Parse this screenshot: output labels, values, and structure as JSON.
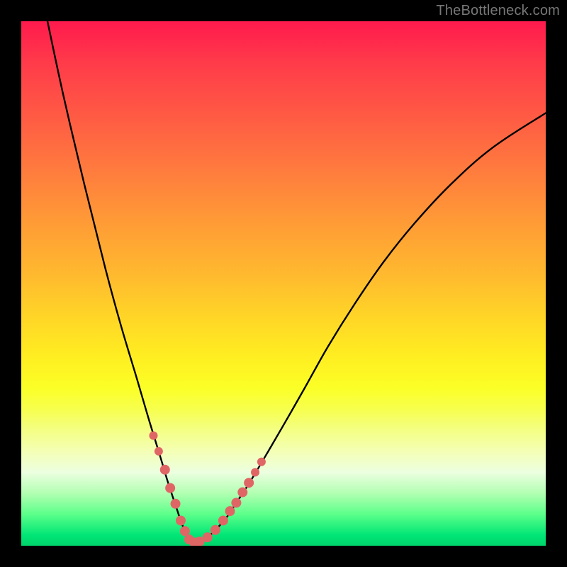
{
  "watermark": "TheBottleneck.com",
  "colors": {
    "background": "#000000",
    "curve": "#000000",
    "markers": "#e06666",
    "gradient_stops": [
      "#ff1a4d",
      "#ff3b4a",
      "#ff5a44",
      "#ff7a3e",
      "#ff9a36",
      "#ffb82f",
      "#ffd427",
      "#ffee21",
      "#fbff27",
      "#f7ff4e",
      "#f4ff85",
      "#f4ffb5",
      "#ecffe0",
      "#b2ffb2",
      "#5cff8a",
      "#00e676",
      "#00d46a"
    ]
  },
  "chart_data": {
    "type": "line",
    "title": "",
    "xlabel": "",
    "ylabel": "",
    "xlim": [
      0,
      100
    ],
    "ylim": [
      0,
      100
    ],
    "grid": false,
    "series": [
      {
        "name": "curve",
        "x": [
          5,
          8,
          12,
          16,
          19,
          22,
          24.5,
          26.5,
          28,
          29.5,
          30.4,
          31.2,
          32,
          33,
          34,
          35.5,
          37,
          39,
          41,
          43.5,
          46.5,
          50,
          54,
          58.5,
          63.5,
          69,
          75,
          82,
          90,
          100
        ],
        "y": [
          100,
          86,
          69,
          53,
          42,
          32,
          23.5,
          17,
          12,
          7.5,
          4.8,
          2.8,
          1.2,
          0.6,
          0.8,
          1.6,
          3,
          5.2,
          8.2,
          12,
          17,
          23,
          30,
          38,
          46,
          54,
          61.5,
          69,
          76,
          82.5
        ]
      }
    ],
    "markers": {
      "name": "highlight-dots",
      "x": [
        25.2,
        26.2,
        27.4,
        28.4,
        29.4,
        30.4,
        31.2,
        32,
        33,
        34,
        35.5,
        37,
        38.5,
        39.8,
        41,
        42.2,
        43.4,
        44.6,
        45.8
      ],
      "y": [
        21,
        18,
        14.5,
        11,
        8,
        4.8,
        2.8,
        1.2,
        0.6,
        0.8,
        1.6,
        3,
        4.8,
        6.6,
        8.2,
        10.2,
        12,
        14,
        16
      ],
      "r": [
        6,
        6,
        7,
        7,
        7,
        7,
        7,
        7,
        7,
        7,
        7,
        7,
        7,
        7,
        7,
        7,
        7,
        6,
        6
      ]
    }
  }
}
